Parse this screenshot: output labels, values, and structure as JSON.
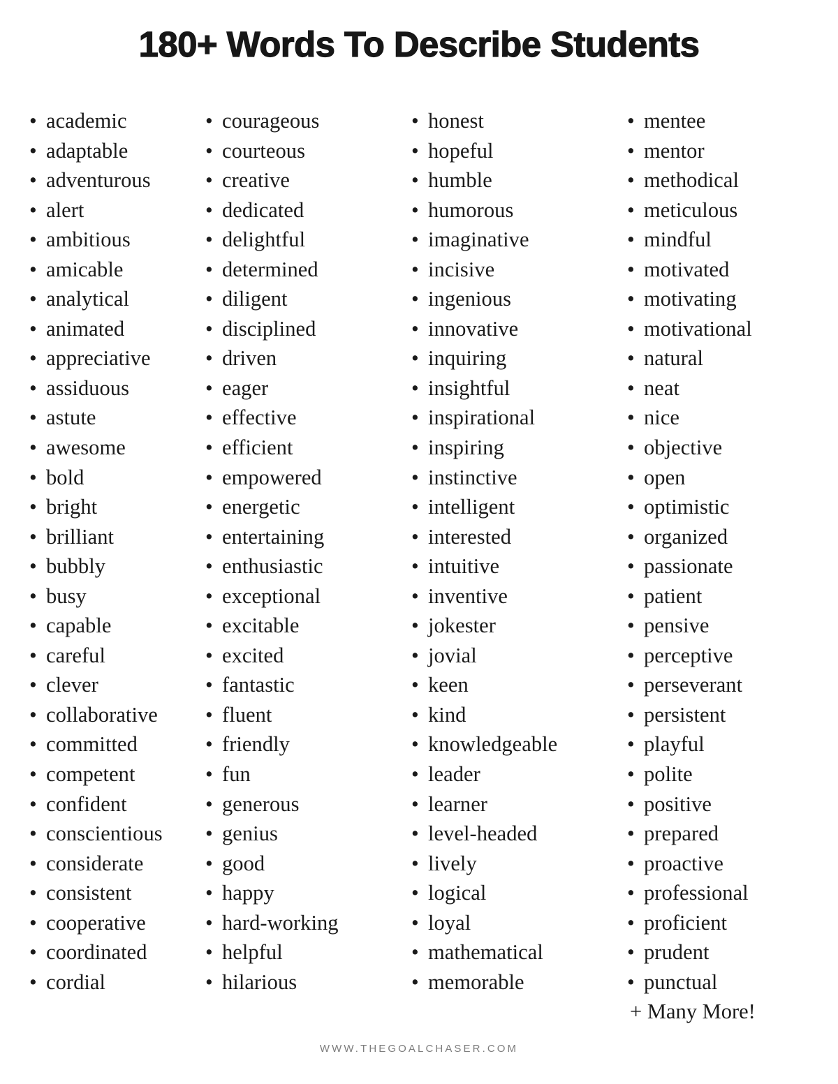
{
  "page": {
    "title": "180+ Words To Describe Students",
    "background_color": "#ffffff",
    "text_color": "#1a1a1a",
    "bullet_glyph": "•"
  },
  "columns": [
    {
      "index": 0,
      "words": [
        "academic",
        "adaptable",
        "adventurous",
        "alert",
        "ambitious",
        "amicable",
        "analytical",
        "animated",
        "appreciative",
        "assiduous",
        "astute",
        "awesome",
        "bold",
        "bright",
        "brilliant",
        "bubbly",
        "busy",
        "capable",
        "careful",
        "clever",
        "collaborative",
        "committed",
        "competent",
        "confident",
        "conscientious",
        "considerate",
        "consistent",
        "cooperative",
        "coordinated",
        "cordial"
      ]
    },
    {
      "index": 1,
      "words": [
        "courageous",
        "courteous",
        "creative",
        "dedicated",
        "delightful",
        "determined",
        "diligent",
        "disciplined",
        "driven",
        "eager",
        "effective",
        "efficient",
        "empowered",
        "energetic",
        "entertaining",
        "enthusiastic",
        "exceptional",
        "excitable",
        "excited",
        "fantastic",
        "fluent",
        "friendly",
        "fun",
        "generous",
        "genius",
        "good",
        "happy",
        "hard-working",
        "helpful",
        "hilarious"
      ]
    },
    {
      "index": 2,
      "words": [
        "honest",
        "hopeful",
        "humble",
        "humorous",
        "imaginative",
        "incisive",
        "ingenious",
        "innovative",
        "inquiring",
        "insightful",
        "inspirational",
        "inspiring",
        "instinctive",
        "intelligent",
        "interested",
        "intuitive",
        "inventive",
        "jokester",
        "jovial",
        "keen",
        "kind",
        "knowledgeable",
        "leader",
        "learner",
        "level-headed",
        "lively",
        "logical",
        "loyal",
        "mathematical",
        "memorable"
      ]
    },
    {
      "index": 3,
      "words": [
        "mentee",
        "mentor",
        "methodical",
        "meticulous",
        "mindful",
        "motivated",
        "motivating",
        "motivational",
        "natural",
        "neat",
        "nice",
        "objective",
        "open",
        "optimistic",
        "organized",
        "passionate",
        "patient",
        "pensive",
        "perceptive",
        "perseverant",
        "persistent",
        "playful",
        "polite",
        "positive",
        "prepared",
        "proactive",
        "professional",
        "proficient",
        "prudent",
        "punctual"
      ],
      "trailing_note": "+ Many More!"
    }
  ],
  "footer": {
    "website": "WWW.THEGOALCHASER.COM",
    "color": "#7d7d7d"
  }
}
